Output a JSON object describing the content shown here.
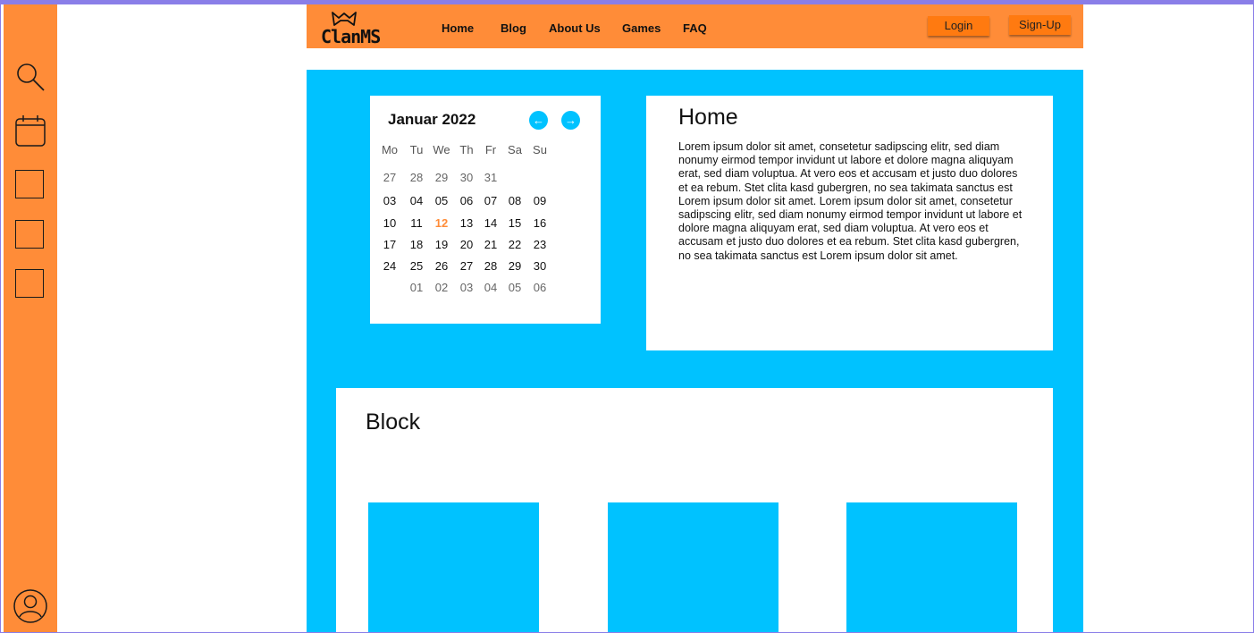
{
  "brand": {
    "logo_text": "ClanMS",
    "accent": "#ff8c38",
    "primary": "#00c2ff"
  },
  "sidebar": {
    "icons": [
      "search-icon",
      "calendar-icon",
      "square-icon",
      "square-icon",
      "square-icon",
      "user-icon"
    ]
  },
  "nav": {
    "links": [
      "Home",
      "Blog",
      "About Us",
      "Games",
      "FAQ"
    ],
    "login_label": "Login",
    "signup_label": "Sign-Up"
  },
  "calendar": {
    "title": "Januar 2022",
    "prev_icon": "←",
    "next_icon": "→",
    "weekdays": [
      "Mo",
      "Tu",
      "We",
      "Th",
      "Fr",
      "Sa",
      "Su"
    ],
    "rows": [
      [
        "27",
        "28",
        "29",
        "30",
        "31",
        "",
        ""
      ],
      [
        "03",
        "04",
        "05",
        "06",
        "07",
        "08",
        "09"
      ],
      [
        "10",
        "11",
        "12",
        "13",
        "14",
        "15",
        "16"
      ],
      [
        "17",
        "18",
        "19",
        "20",
        "21",
        "22",
        "23"
      ],
      [
        "24",
        "25",
        "26",
        "27",
        "28",
        "29",
        "30"
      ],
      [
        "",
        "01",
        "02",
        "03",
        "04",
        "05",
        "06"
      ]
    ],
    "today": "12"
  },
  "home": {
    "title": "Home",
    "text": "Lorem ipsum dolor sit amet, consetetur sadipscing elitr, sed diam nonumy eirmod tempor invidunt ut labore et dolore magna aliquyam erat, sed diam voluptua. At vero eos et accusam et justo duo dolores et ea rebum. Stet clita kasd gubergren, no sea takimata sanctus est Lorem ipsum dolor sit amet. Lorem ipsum dolor sit amet, consetetur sadipscing elitr, sed diam nonumy eirmod tempor invidunt ut labore et dolore magna aliquyam erat, sed diam voluptua. At vero eos et accusam et justo duo dolores et ea rebum. Stet clita kasd gubergren, no sea takimata sanctus est Lorem ipsum dolor sit amet."
  },
  "block": {
    "title": "Block"
  }
}
